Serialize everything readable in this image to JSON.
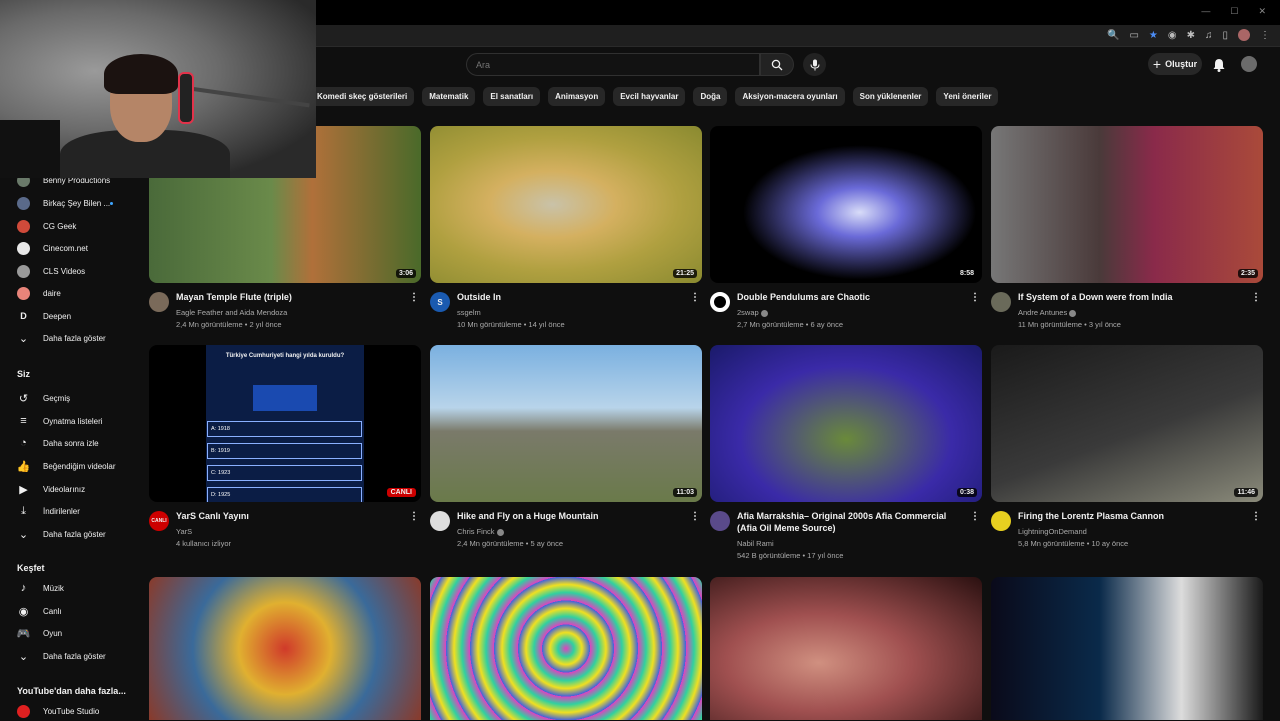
{
  "search": {
    "placeholder": "Ara"
  },
  "header": {
    "create_label": "Oluştur"
  },
  "chips": [
    "Komedi skeç gösterileri",
    "Matematik",
    "El sanatları",
    "Animasyon",
    "Evcil hayvanlar",
    "Doğa",
    "Aksiyon-macera oyunları",
    "Son yüklenenler",
    "Yeni öneriler"
  ],
  "sidebar": {
    "subscriptions": [
      {
        "label": "Benny Productions",
        "color": "#6a7a6a"
      },
      {
        "label": "Birkaç Şey Bilen ...",
        "color": "#5a6a8a"
      },
      {
        "label": "CG Geek",
        "color": "#d04a3a"
      },
      {
        "label": "Cinecom.net",
        "color": "#e8e8e8"
      },
      {
        "label": "CLS Videos",
        "color": "#9a9a9a"
      },
      {
        "label": "daire",
        "color": "#e8847a"
      },
      {
        "label": "Deepen",
        "color": "#0f0f0f"
      },
      {
        "label": "Daha fazla göster",
        "color": ""
      }
    ],
    "you_header": "Siz",
    "you_items": [
      "Geçmiş",
      "Oynatma listeleri",
      "Daha sonra izle",
      "Beğendiğim videolar",
      "Videolarınız",
      "İndirilenler",
      "Daha fazla göster"
    ],
    "explore_header": "Keşfet",
    "explore_items": [
      "Müzik",
      "Canlı",
      "Oyun",
      "Daha fazla göster"
    ],
    "more_header": "YouTube'dan daha fazla...",
    "more_items": [
      "YouTube Studio"
    ]
  },
  "videos": [
    {
      "title": "Mayan Temple Flute (triple)",
      "channel": "Eagle Feather and Aida Mendoza",
      "stats": "2,4 Mn görüntüleme • 2 yıl önce",
      "duration": "3:06"
    },
    {
      "title": "Outside In",
      "channel": "ssgelm",
      "stats": "10 Mn görüntüleme • 14 yıl önce",
      "duration": "21:25",
      "avatar_letter": "S"
    },
    {
      "title": "Double Pendulums are Chaotic",
      "channel": "2swap",
      "stats": "2,7 Mn görüntüleme • 6 ay önce",
      "duration": "8:58"
    },
    {
      "title": "If System of a Down were from India",
      "channel": "Andre Antunes",
      "stats": "11 Mn görüntüleme • 3 yıl önce",
      "duration": "2:35"
    },
    {
      "title": "YarS Canlı Yayını",
      "channel": "YarS",
      "stats": "4 kullanıcı izliyor",
      "live": "CANLI",
      "avatar_text": "CANLI"
    },
    {
      "title": "Hike and Fly on a Huge Mountain",
      "channel": "Chris Finck",
      "stats": "2,4 Mn görüntüleme • 5 ay önce",
      "duration": "11:03"
    },
    {
      "title": "Afia Marrakshia– Original 2000s Afia Commercial (Afia Oil Meme Source)",
      "channel": "Nabil Rami",
      "stats": "542 B görüntüleme • 17 yıl önce",
      "duration": "0:38"
    },
    {
      "title": "Firing the Lorentz Plasma Cannon",
      "channel": "LightningOnDemand",
      "stats": "5,8 Mn görüntüleme • 10 ay önce",
      "duration": "11:46"
    }
  ],
  "quiz": {
    "question": "Türkiye Cumhuriyeti hangi yılda kuruldu?",
    "options": [
      "A: 1918",
      "B: 1919",
      "C: 1923",
      "D: 1925"
    ]
  }
}
